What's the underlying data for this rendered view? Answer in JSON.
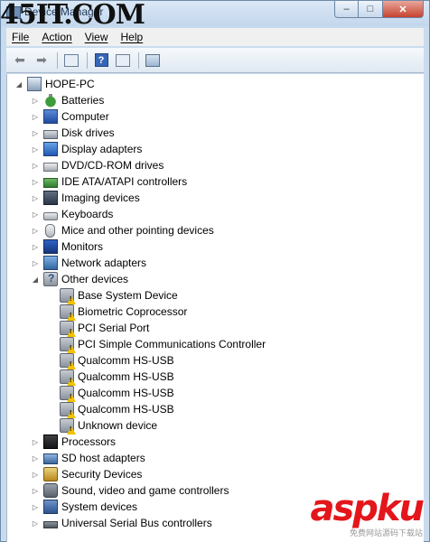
{
  "window": {
    "title": "Device Manager"
  },
  "watermark": {
    "text": "45IT.COM"
  },
  "window_buttons": {
    "minimize": "–",
    "maximize": "□",
    "close": "✕"
  },
  "menu": [
    {
      "label": "File"
    },
    {
      "label": "Action"
    },
    {
      "label": "View"
    },
    {
      "label": "Help"
    }
  ],
  "toolbar": {
    "back_icon": "back-arrow-icon",
    "forward_icon": "forward-arrow-icon",
    "help_glyph": "?"
  },
  "tree": {
    "root": "HOPE-PC",
    "expanded_glyph": "◢",
    "collapsed_glyph": "▷",
    "categories": [
      {
        "label": "Batteries",
        "icon": "battery-icon"
      },
      {
        "label": "Computer",
        "icon": "computer-icon"
      },
      {
        "label": "Disk drives",
        "icon": "disk-drive-icon"
      },
      {
        "label": "Display adapters",
        "icon": "display-adapter-icon"
      },
      {
        "label": "DVD/CD-ROM drives",
        "icon": "dvd-icon"
      },
      {
        "label": "IDE ATA/ATAPI controllers",
        "icon": "ide-icon"
      },
      {
        "label": "Imaging devices",
        "icon": "imaging-icon"
      },
      {
        "label": "Keyboards",
        "icon": "keyboard-icon"
      },
      {
        "label": "Mice and other pointing devices",
        "icon": "mouse-icon"
      },
      {
        "label": "Monitors",
        "icon": "monitor-icon"
      },
      {
        "label": "Network adapters",
        "icon": "network-icon"
      },
      {
        "label": "Other devices",
        "icon": "other-devices-icon",
        "expanded": true,
        "children": [
          "Base System Device",
          "Biometric Coprocessor",
          "PCI Serial Port",
          "PCI Simple Communications Controller",
          "Qualcomm HS-USB",
          "Qualcomm HS-USB",
          "Qualcomm HS-USB",
          "Qualcomm HS-USB",
          "Unknown device"
        ]
      },
      {
        "label": "Processors",
        "icon": "processor-icon"
      },
      {
        "label": "SD host adapters",
        "icon": "sd-icon"
      },
      {
        "label": "Security Devices",
        "icon": "security-icon"
      },
      {
        "label": "Sound, video and game controllers",
        "icon": "sound-icon"
      },
      {
        "label": "System devices",
        "icon": "system-icon"
      },
      {
        "label": "Universal Serial Bus controllers",
        "icon": "usb-icon"
      }
    ]
  },
  "brand": {
    "logo": "aspku",
    "sub": "免费网站源码下载站"
  },
  "colors": {
    "warning": "#f2c200",
    "logo": "#e3161b",
    "title_text": "#1e395b"
  }
}
